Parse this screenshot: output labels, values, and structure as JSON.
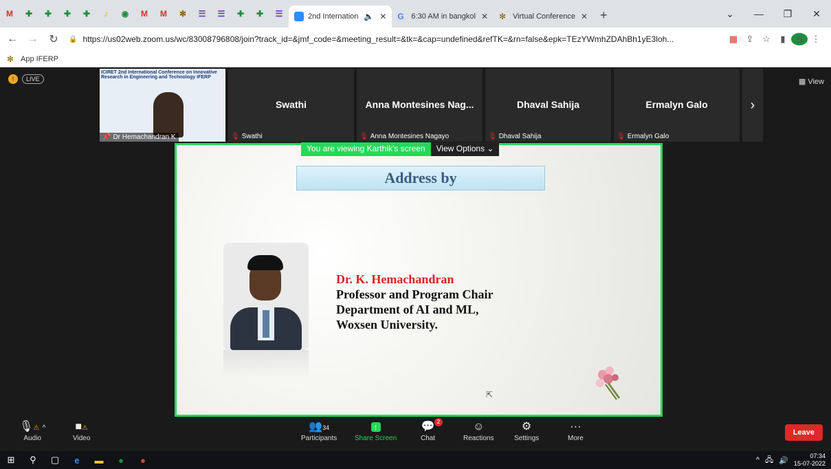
{
  "browser": {
    "pinned_tabs": [
      {
        "icon": "gmail-icon",
        "glyph": "M",
        "color": "#d93025"
      },
      {
        "icon": "classroom-icon",
        "glyph": "✚",
        "color": "#1e8e3e"
      },
      {
        "icon": "classroom-icon",
        "glyph": "✚",
        "color": "#1e8e3e"
      },
      {
        "icon": "classroom-icon",
        "glyph": "✚",
        "color": "#1e8e3e"
      },
      {
        "icon": "classroom-icon",
        "glyph": "✚",
        "color": "#1e8e3e"
      },
      {
        "icon": "drive-icon",
        "glyph": "♪",
        "color": "#f4b400"
      },
      {
        "icon": "app-icon",
        "glyph": "◉",
        "color": "#1e8e3e"
      },
      {
        "icon": "gmail-icon",
        "glyph": "M",
        "color": "#d93025"
      },
      {
        "icon": "gmail-icon",
        "glyph": "M",
        "color": "#d93025"
      },
      {
        "icon": "iferp-icon",
        "glyph": "✻",
        "color": "#8a5a00"
      },
      {
        "icon": "forms-icon",
        "glyph": "☰",
        "color": "#673ab7"
      },
      {
        "icon": "forms-icon",
        "glyph": "☰",
        "color": "#673ab7"
      },
      {
        "icon": "classroom-icon",
        "glyph": "✚",
        "color": "#1e8e3e"
      },
      {
        "icon": "classroom-icon",
        "glyph": "✚",
        "color": "#1e8e3e"
      },
      {
        "icon": "forms-icon",
        "glyph": "☰",
        "color": "#673ab7"
      }
    ],
    "tabs": [
      {
        "title": "2nd Internation",
        "active": true,
        "audio": "🔈"
      },
      {
        "title": "6:30 AM in bangkol",
        "active": false
      },
      {
        "title": "Virtual Conference",
        "active": false
      }
    ],
    "new_tab": "+",
    "url": "https://us02web.zoom.us/wc/83008796808/join?track_id=&jmf_code=&meeting_result=&tk=&cap=undefined&refTK=&rn=false&epk=TEzYWmhZDAhBh1yE3loh...",
    "profile_initial": "S",
    "bookmark": "App IFERP"
  },
  "zoom": {
    "live_badge": "LIVE",
    "view_label": "View",
    "participants": [
      {
        "name": "Dr Hemachandran K",
        "video": true
      },
      {
        "name": "Swathi",
        "label": "Swathi"
      },
      {
        "name": "Anna Montesines Nag...",
        "label": "Anna Montesines Nagayo"
      },
      {
        "name": "Dhaval Sahija",
        "label": "Dhaval Sahija"
      },
      {
        "name": "Ermalyn Galo",
        "label": "Ermalyn Galo"
      }
    ],
    "thumb_header": "ICIRET  2nd International Conference on Innovative Research in Engineering and Technology  IFERP",
    "viewing_text": "You are viewing Karthik's screen",
    "view_options": "View Options ⌄",
    "slide": {
      "title": "Address by",
      "name": "Dr. K. Hemachandran",
      "line1": "Professor and Program Chair",
      "line2": "Department of AI and ML,",
      "line3": "Woxsen University."
    },
    "toolbar": {
      "audio": "Audio",
      "video": "Video",
      "participants": "Participants",
      "participants_count": "34",
      "share": "Share Screen",
      "chat": "Chat",
      "chat_badge": "2",
      "reactions": "Reactions",
      "settings": "Settings",
      "more": "More",
      "leave": "Leave"
    }
  },
  "taskbar": {
    "time": "07:34",
    "date": "15-07-2022"
  }
}
